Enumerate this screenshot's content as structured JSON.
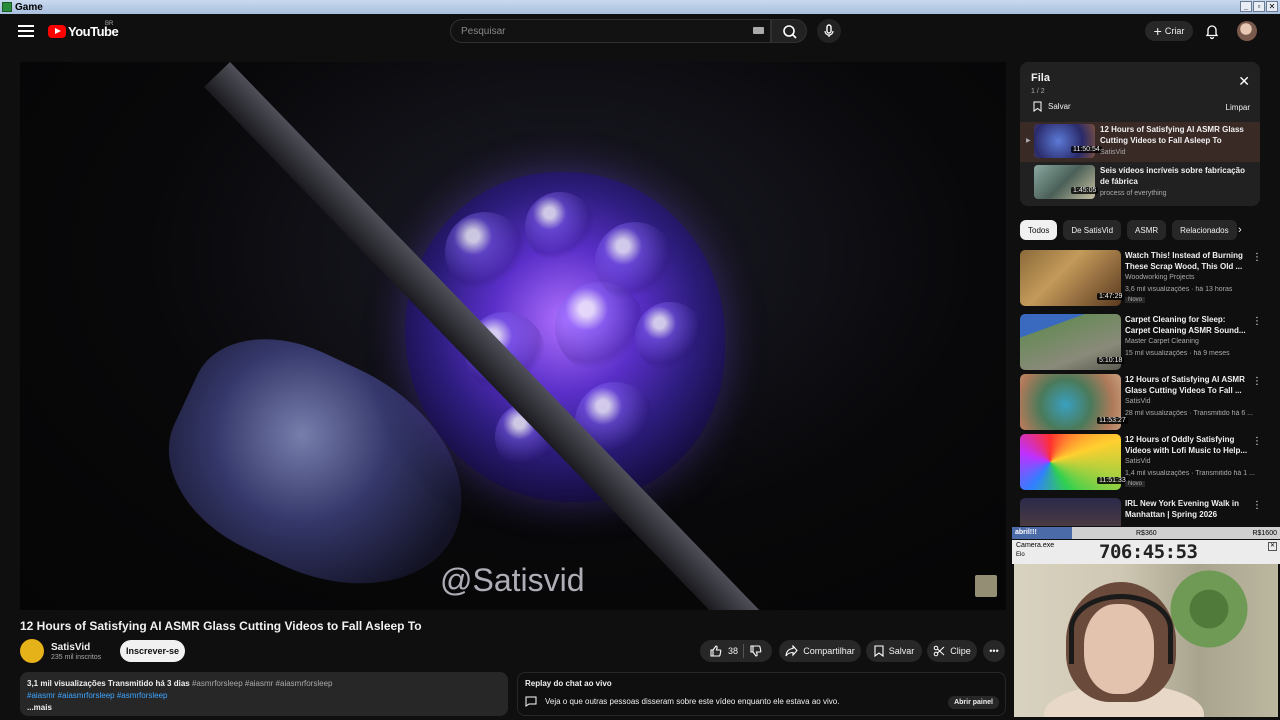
{
  "window": {
    "title": "Game",
    "buttons": [
      "_",
      "▫",
      "✕"
    ]
  },
  "header": {
    "logo_text": "YouTube",
    "country": "BR",
    "search_placeholder": "Pesquisar",
    "create_label": "Criar"
  },
  "video": {
    "watermark": "@Satisvid",
    "title": "12 Hours of Satisfying AI ASMR Glass Cutting Videos to Fall Asleep To"
  },
  "channel": {
    "name": "SatisVid",
    "subscribers": "235 mil inscritos",
    "subscribe_label": "Inscrever-se"
  },
  "actions": {
    "likes": "38",
    "share": "Compartilhar",
    "save": "Salvar",
    "clip": "Clipe"
  },
  "description": {
    "stats": "3,1 mil visualizações  Transmitido há 3 dias",
    "tags_gray": "#asmrforsleep #aiasmr #aiasmrforsleep",
    "tags_blue": "#aiasmr #aiasmrforsleep #asmrforsleep",
    "more": "...mais"
  },
  "chat": {
    "title": "Replay do chat ao vivo",
    "text": "Veja o que outras pessoas disseram sobre este vídeo enquanto ele estava ao vivo.",
    "open_label": "Abrir painel"
  },
  "queue": {
    "title": "Fila",
    "count": "1 / 2",
    "save": "Salvar",
    "clear": "Limpar",
    "items": [
      {
        "title": "12 Hours of Satisfying AI ASMR Glass Cutting Videos to Fall Asleep To",
        "channel": "SatisVid",
        "duration": "11:50:54"
      },
      {
        "title": "Seis vídeos incríveis sobre fabricação de fábrica",
        "channel": "process of everything",
        "duration": "1:45:05"
      }
    ]
  },
  "chips": [
    "Todos",
    "De SatisVid",
    "ASMR",
    "Relacionados"
  ],
  "recommendations": [
    {
      "title": "Watch This! Instead of Burning These Scrap Wood, This Old ...",
      "channel": "Woodworking Projects",
      "meta": "3,6 mil visualizações · há 13 horas",
      "badge": "Novo",
      "duration": "1:47:29"
    },
    {
      "title": "Carpet Cleaning for Sleep: Carpet Cleaning ASMR Sound...",
      "channel": "Master Carpet Cleaning",
      "meta": "15 mil visualizações · há 9 meses",
      "badge": "",
      "duration": "5:10:18"
    },
    {
      "title": "12 Hours of Satisfying AI ASMR Glass Cutting Videos To Fall ...",
      "channel": "SatisVid",
      "meta": "28 mil visualizações · Transmitido há 6 ...",
      "badge": "",
      "duration": "11:53:27"
    },
    {
      "title": "12 Hours of Oddly Satisfying Videos with Lofi Music to Help...",
      "channel": "SatisVid",
      "meta": "1,4 mil visualizações · Transmitido há 1 ...",
      "badge": "Novo",
      "duration": "11:51:33"
    },
    {
      "title": "IRL New York Evening Walk in Manhattan | Spring 2026",
      "channel": "",
      "meta": "",
      "badge": "",
      "duration": ""
    }
  ],
  "overlay": {
    "bar_left": "abril!!!",
    "bar_mid": "R$360",
    "bar_right": "R$1600",
    "camera_name": "Camera.exe",
    "camera_file": "Elo",
    "timer": "706:45:53"
  }
}
